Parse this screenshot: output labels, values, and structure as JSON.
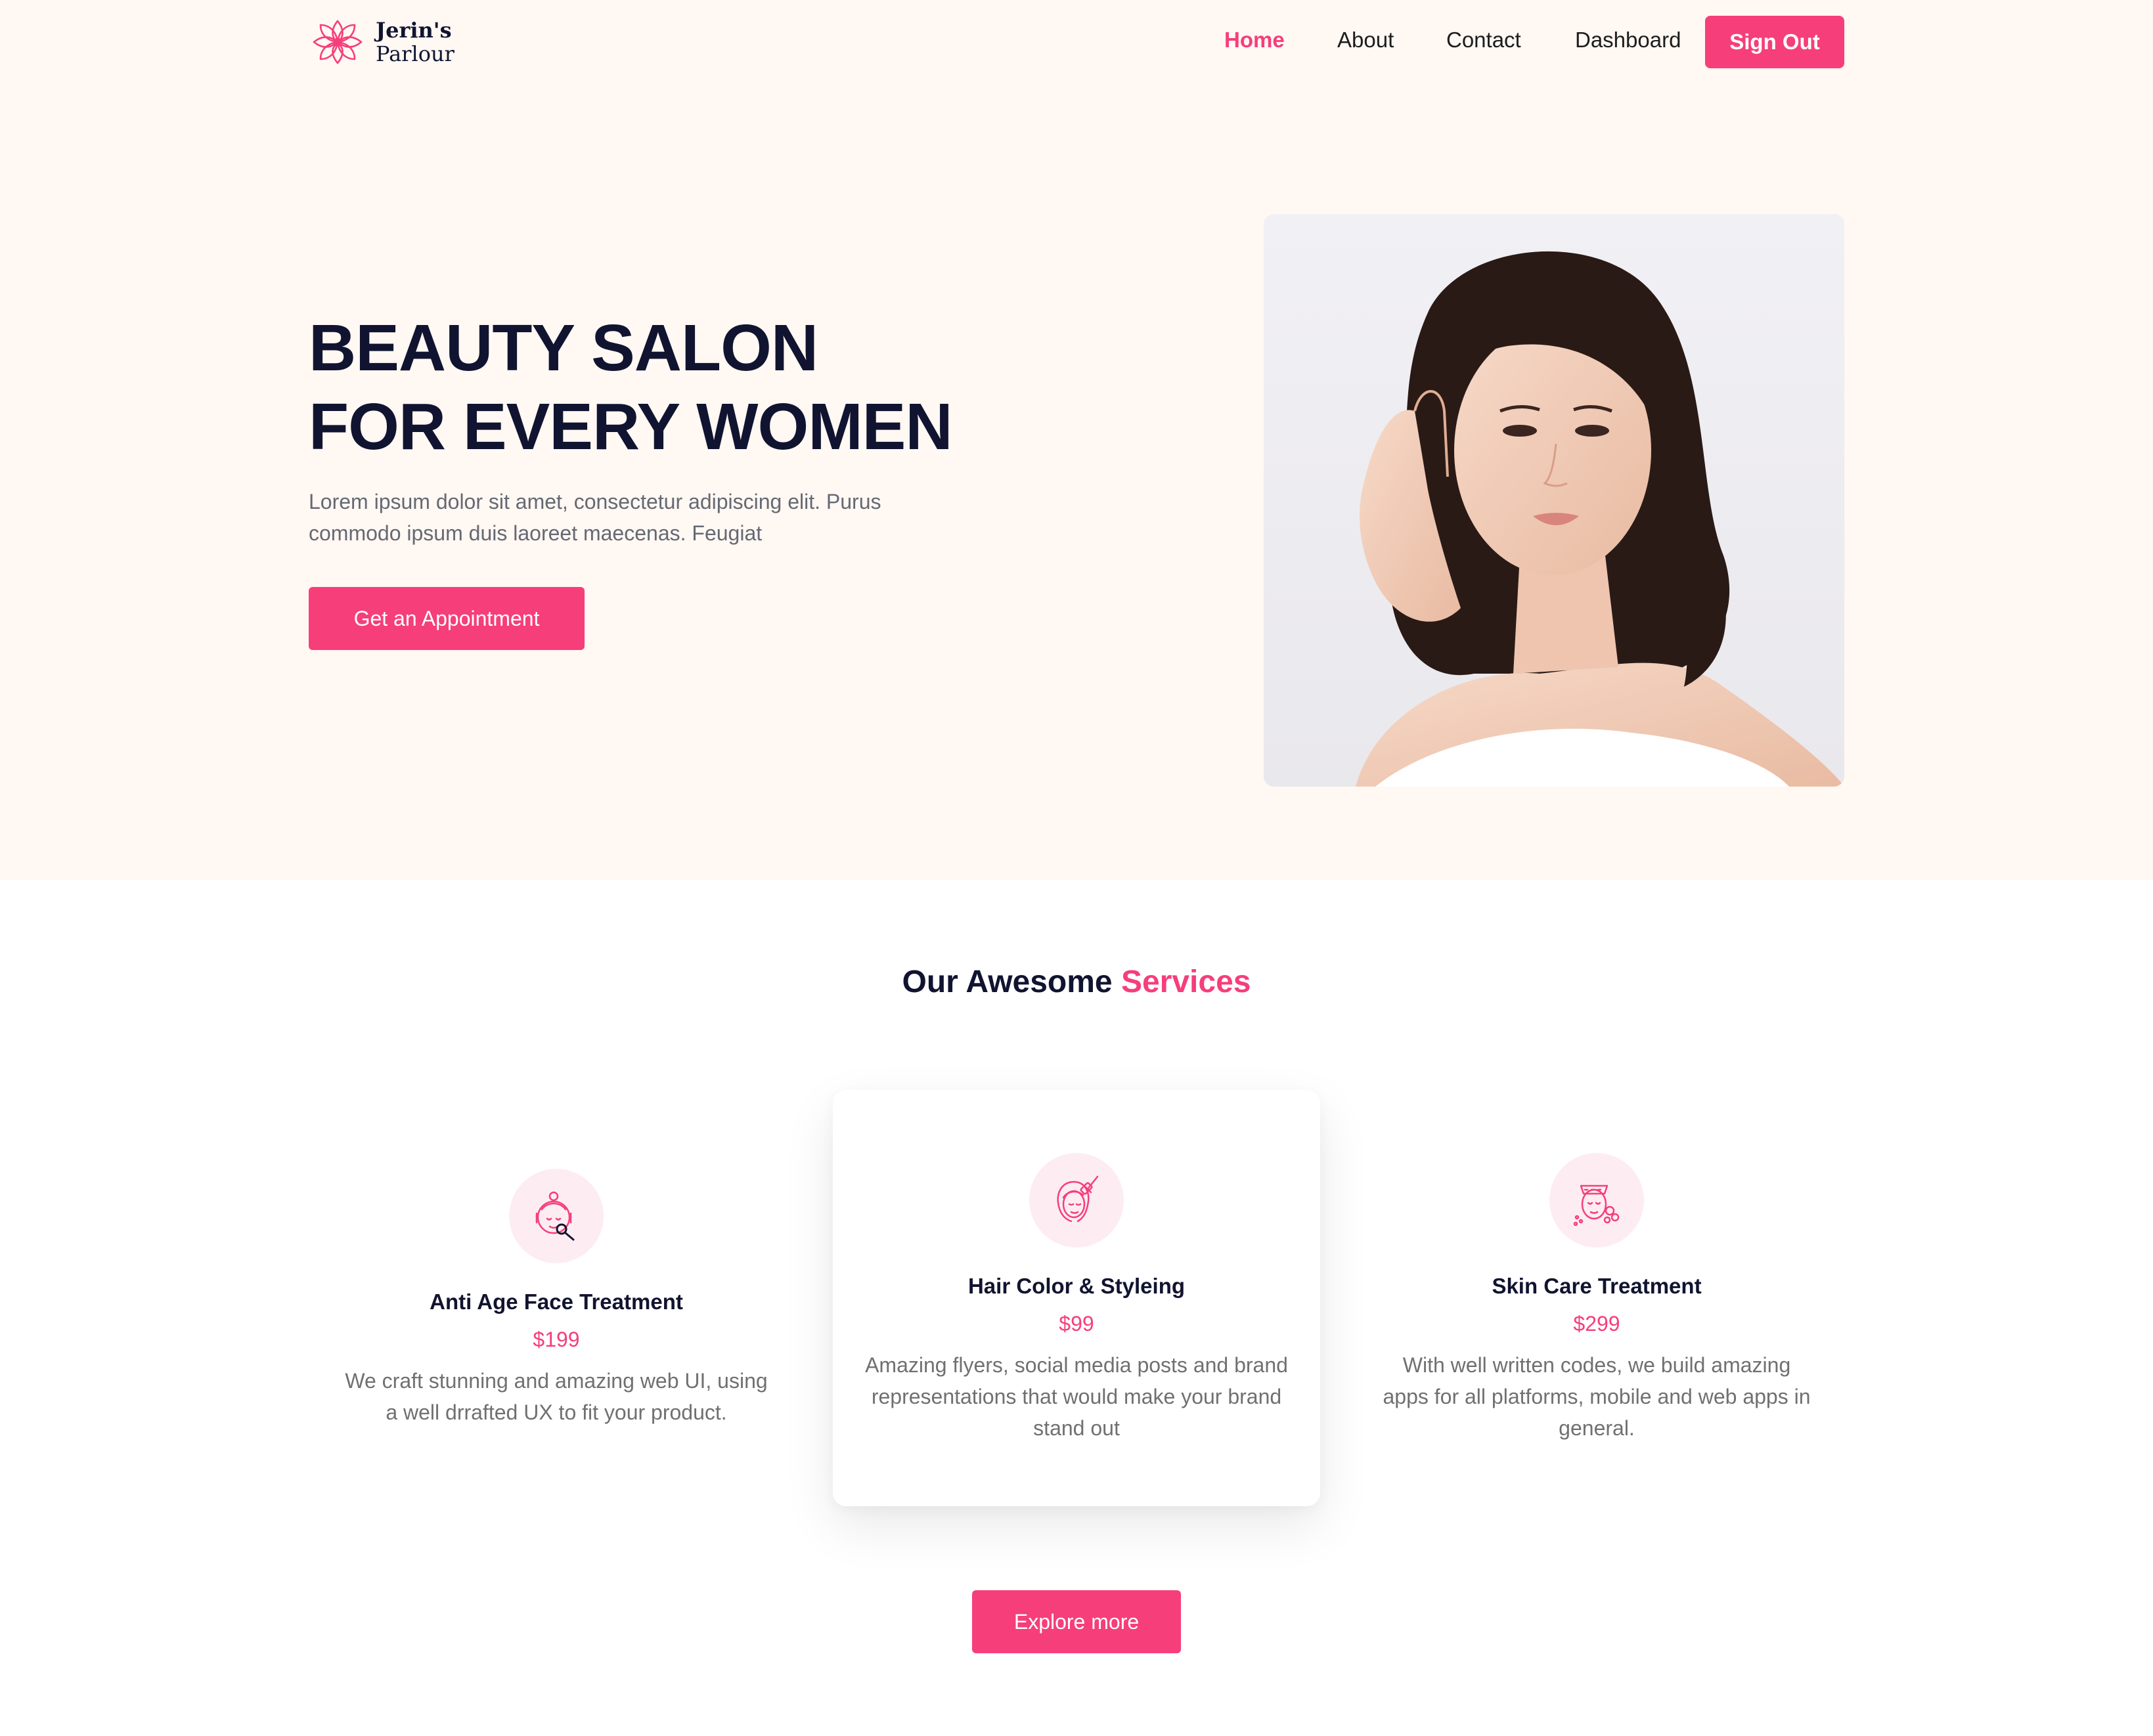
{
  "brand": {
    "name_line1": "Jerin's",
    "name_line2": "Parlour",
    "logo_icon": "lotus-flower-icon"
  },
  "nav": {
    "items": [
      {
        "label": "Home",
        "active": true
      },
      {
        "label": "About",
        "active": false
      },
      {
        "label": "Contact",
        "active": false
      },
      {
        "label": "Dashboard",
        "active": false
      }
    ],
    "signout_label": "Sign Out"
  },
  "hero": {
    "title_line1": "BEAUTY SALON",
    "title_line2": "FOR EVERY WOMEN",
    "description": "Lorem ipsum dolor sit amet, consectetur adipiscing elit. Purus commodo ipsum duis laoreet maecenas. Feugiat",
    "cta_label": "Get an Appointment",
    "image": "portrait-woman-touching-face"
  },
  "services": {
    "heading_prefix": "Our Awesome",
    "heading_accent": "Services",
    "items": [
      {
        "icon": "face-treatment-icon",
        "title": "Anti Age Face Treatment",
        "price": "$199",
        "description": "We craft stunning and amazing web UI, using a well drrafted UX to fit your product."
      },
      {
        "icon": "hair-styling-icon",
        "title": "Hair Color & Styleing",
        "price": "$99",
        "description": "Amazing flyers, social media posts and brand representations that would make your brand stand out"
      },
      {
        "icon": "skin-care-icon",
        "title": "Skin Care Treatment",
        "price": "$299",
        "description": "With well written codes, we build amazing apps for all platforms, mobile and web apps in general."
      }
    ],
    "explore_label": "Explore more"
  },
  "colors": {
    "accent": "#F63E7B",
    "hero_bg": "#FFF8F3",
    "heading": "#111430",
    "muted": "#666873",
    "icon_bg": "#FDEDF2"
  }
}
